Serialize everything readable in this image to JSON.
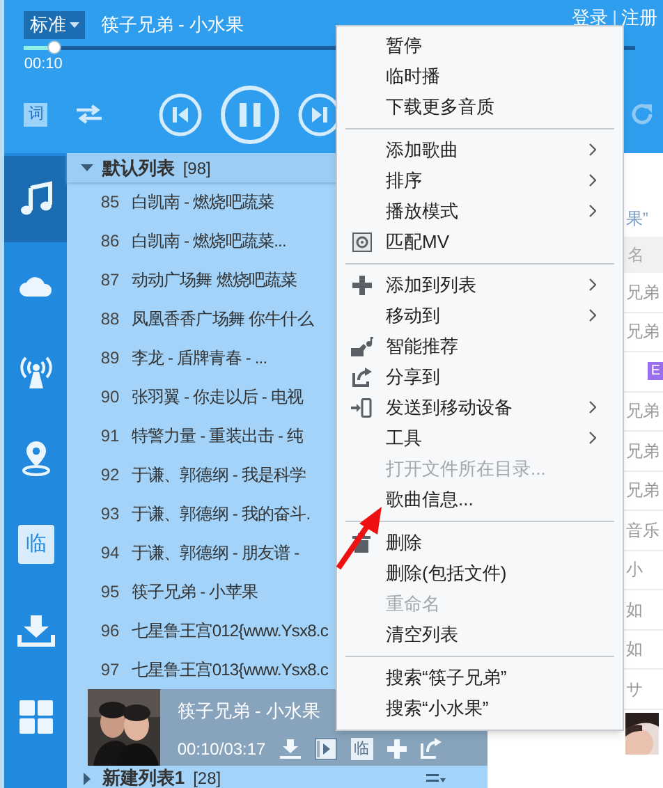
{
  "player": {
    "quality": "标准",
    "now_playing": "筷子兄弟 - 小水果",
    "elapsed": "00:10",
    "lyrics_button": "词",
    "playing": true,
    "account": {
      "login": "登录",
      "separator": "|",
      "register": "注册"
    }
  },
  "sidebar": [
    {
      "kind": "music",
      "selected": true
    },
    {
      "kind": "cloud",
      "selected": false
    },
    {
      "kind": "radio",
      "selected": false
    },
    {
      "kind": "location",
      "selected": false
    },
    {
      "kind": "temp",
      "label": "临",
      "selected": false
    },
    {
      "kind": "download",
      "selected": false
    },
    {
      "kind": "apps",
      "selected": false
    }
  ],
  "playlist": {
    "name": "默认列表",
    "count": "[98]",
    "expanded": true,
    "rows": [
      {
        "number": "85",
        "title": "白凯南 - 燃烧吧蔬菜"
      },
      {
        "number": "86",
        "title": "白凯南 - 燃烧吧蔬菜..."
      },
      {
        "number": "87",
        "title": "动动广场舞 燃烧吧蔬菜"
      },
      {
        "number": "88",
        "title": "凤凰香香广场舞 你牛什么"
      },
      {
        "number": "89",
        "title": "李龙 - 盾牌青春 - ..."
      },
      {
        "number": "90",
        "title": "张羽翼 - 你走以后 - 电视"
      },
      {
        "number": "91",
        "title": "特警力量 - 重装出击 - 纯"
      },
      {
        "number": "92",
        "title": "于谦、郭德纲 - 我是科学"
      },
      {
        "number": "93",
        "title": "于谦、郭德纲 - 我的奋斗."
      },
      {
        "number": "94",
        "title": "于谦、郭德纲 - 朋友谱 -"
      },
      {
        "number": "95",
        "title": "筷子兄弟 - 小苹果"
      },
      {
        "number": "96",
        "title": "七星鲁王宫012{www.Ysx8.c"
      },
      {
        "number": "97",
        "title": "七星鲁王宫013{www.Ysx8.c"
      }
    ]
  },
  "now_playing_bar": {
    "title": "筷子兄弟 - 小水果",
    "time": "00:10/03:17",
    "temp_label": "临"
  },
  "next_playlist": {
    "name": "新建列表1",
    "count": "[28]",
    "expanded": false
  },
  "search_panel": {
    "heading": "果”",
    "column_header": "名",
    "rows": [
      {
        "kind": "text",
        "text": "兄弟"
      },
      {
        "kind": "text",
        "text": "兄弟"
      },
      {
        "kind": "badge",
        "text": "E"
      },
      {
        "kind": "text",
        "text": "兄弟"
      },
      {
        "kind": "text",
        "text": "兄弟"
      },
      {
        "kind": "text",
        "text": "兄弟"
      },
      {
        "kind": "text",
        "text": "音乐"
      },
      {
        "kind": "text",
        "text": "小"
      },
      {
        "kind": "text",
        "text": "如"
      },
      {
        "kind": "text",
        "text": "如"
      },
      {
        "kind": "text",
        "text": "サ"
      }
    ]
  },
  "context_menu": {
    "sections": [
      [
        {
          "label": "暂停",
          "kind": "plain",
          "submenu": false,
          "disabled": false
        },
        {
          "label": "临时播",
          "kind": "plain",
          "submenu": false,
          "disabled": false
        },
        {
          "label": "下载更多音质",
          "kind": "plain",
          "submenu": false,
          "disabled": false
        }
      ],
      [
        {
          "label": "添加歌曲",
          "kind": "plain",
          "submenu": true,
          "disabled": false
        },
        {
          "label": "排序",
          "kind": "plain",
          "submenu": true,
          "disabled": false
        },
        {
          "label": "播放模式",
          "kind": "plain",
          "submenu": true,
          "disabled": false
        },
        {
          "label": "匹配MV",
          "kind": "film",
          "submenu": false,
          "disabled": false
        }
      ],
      [
        {
          "label": "添加到列表",
          "kind": "plus",
          "submenu": true,
          "disabled": false
        },
        {
          "label": "移动到",
          "kind": "plain",
          "submenu": true,
          "disabled": false
        },
        {
          "label": "智能推荐",
          "kind": "recommend",
          "submenu": false,
          "disabled": false
        },
        {
          "label": "分享到",
          "kind": "share",
          "submenu": false,
          "disabled": false
        },
        {
          "label": "发送到移动设备",
          "kind": "phone",
          "submenu": true,
          "disabled": false
        },
        {
          "label": "工具",
          "kind": "plain",
          "submenu": true,
          "disabled": false
        },
        {
          "label": "打开文件所在目录...",
          "kind": "plain",
          "submenu": false,
          "disabled": true
        },
        {
          "label": "歌曲信息...",
          "kind": "plain",
          "submenu": false,
          "disabled": false
        }
      ],
      [
        {
          "label": "删除",
          "kind": "trash",
          "submenu": false,
          "disabled": false
        },
        {
          "label": "删除(包括文件)",
          "kind": "plain",
          "submenu": false,
          "disabled": false
        },
        {
          "label": "重命名",
          "kind": "plain",
          "submenu": false,
          "disabled": true
        },
        {
          "label": "清空列表",
          "kind": "plain",
          "submenu": false,
          "disabled": false
        }
      ],
      [
        {
          "label": "搜索“筷子兄弟”",
          "kind": "plain",
          "submenu": false,
          "disabled": false
        },
        {
          "label": "搜索“小水果”",
          "kind": "plain",
          "submenu": false,
          "disabled": false
        }
      ]
    ]
  }
}
